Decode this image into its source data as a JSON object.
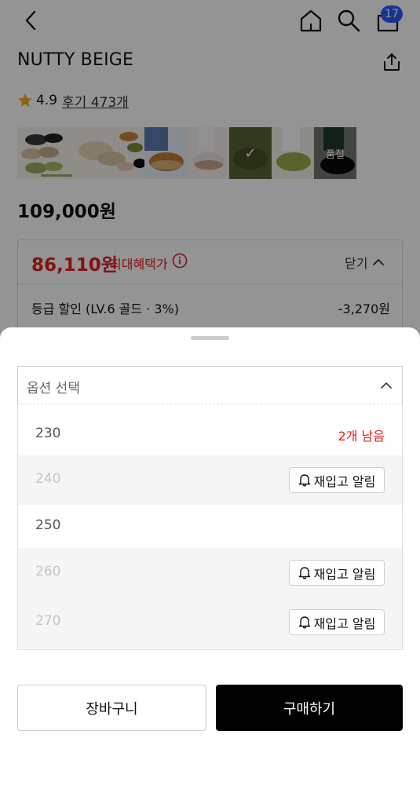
{
  "header": {
    "cart_count": "17"
  },
  "product": {
    "name": "NUTTY BEIGE",
    "rating": "4.9",
    "review_link": "후기 473개",
    "thumb_soldout_label": "품절",
    "price": "109,000원"
  },
  "benefit": {
    "max_price": "86,110원",
    "max_label": "최대혜택가",
    "toggle_label": "닫기",
    "discount_label": "등급 할인 (LV.6 골드 · 3%)",
    "discount_amount": "-3,270원"
  },
  "sheet": {
    "select_label": "옵션 선택",
    "options": [
      {
        "size": "230",
        "status": "2개 남음"
      },
      {
        "size": "240",
        "status": "재입고 알림"
      },
      {
        "size": "250",
        "status": ""
      },
      {
        "size": "260",
        "status": "재입고 알림"
      },
      {
        "size": "270",
        "status": "재입고 알림"
      }
    ],
    "cart_button": "장바구니",
    "buy_button": "구매하기"
  },
  "colors": {
    "accent_red": "#e02020",
    "badge_blue": "#2b5cff",
    "primary_black": "#000000"
  }
}
